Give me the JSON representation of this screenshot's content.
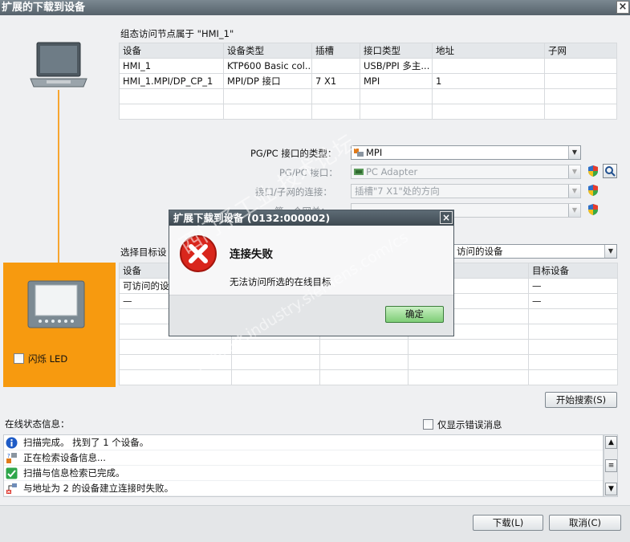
{
  "window": {
    "title": "扩展的下载到设备"
  },
  "node_section": {
    "caption": "组态访问节点属于 \"HMI_1\"",
    "columns": [
      "设备",
      "设备类型",
      "插槽",
      "接口类型",
      "地址",
      "子网"
    ],
    "rows": [
      [
        "HMI_1",
        "KTP600 Basic col...",
        "",
        "USB/PPI 多主...",
        "",
        ""
      ],
      [
        "HMI_1.MPI/DP_CP_1",
        "MPI/DP 接口",
        "7 X1",
        "MPI",
        "1",
        ""
      ]
    ]
  },
  "interface_settings": {
    "type_label": "PG/PC 接口的类型：",
    "type_value": "MPI",
    "iface_label": "PG/PC 接口：",
    "iface_value": "PC Adapter",
    "conn_label": "接口/子网的连接：",
    "conn_value": "插槽\"7 X1\"处的方向",
    "gateway_label": "第一个网关："
  },
  "target_section": {
    "label": "选择目标设",
    "filter_value": "访问的设备",
    "columns": [
      "设备",
      "目标设备"
    ],
    "rows": [
      [
        "可访问的设",
        "—"
      ],
      [
        "—",
        "—"
      ]
    ]
  },
  "device_panel": {
    "flash_led_label": "闪烁 LED"
  },
  "buttons": {
    "start_search": "开始搜索(S)",
    "download": "下载(L)",
    "cancel": "取消(C)"
  },
  "status": {
    "label": "在线状态信息：",
    "errors_only_label": "仅显示错误消息",
    "messages": [
      {
        "icon": "info-icon",
        "text": "扫描完成。 找到了 1 个设备。"
      },
      {
        "icon": "search-device-icon",
        "text": "正在检索设备信息..."
      },
      {
        "icon": "check-icon",
        "text": "扫描与信息检索已完成。"
      },
      {
        "icon": "network-error-icon",
        "text": "与地址为 2 的设备建立连接时失败。"
      }
    ]
  },
  "dialog": {
    "title": "扩展下载到设备 (0132:000002)",
    "heading": "连接失败",
    "message": "无法访问所选的在线目标",
    "ok": "确定"
  },
  "watermark": {
    "line1": "西门子工业 技术论坛",
    "line2": "support.industry.siemens.com/cs"
  },
  "colors": {
    "accent_orange": "#f79a0f",
    "error_red": "#d9261c",
    "ok_green": "#7fcd77"
  }
}
